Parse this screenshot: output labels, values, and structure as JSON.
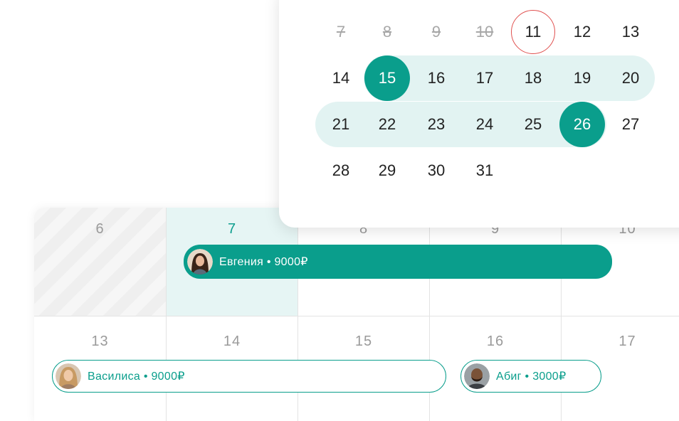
{
  "date_picker": {
    "weeks": [
      [
        {
          "d": "7",
          "state": "disabled"
        },
        {
          "d": "8",
          "state": "disabled"
        },
        {
          "d": "9",
          "state": "disabled"
        },
        {
          "d": "10",
          "state": "disabled"
        },
        {
          "d": "11",
          "state": "current"
        },
        {
          "d": "12",
          "state": "normal"
        },
        {
          "d": "13",
          "state": "normal"
        }
      ],
      [
        {
          "d": "14",
          "state": "normal"
        },
        {
          "d": "15",
          "state": "selected"
        },
        {
          "d": "16",
          "state": "normal"
        },
        {
          "d": "17",
          "state": "normal"
        },
        {
          "d": "18",
          "state": "normal"
        },
        {
          "d": "19",
          "state": "normal"
        },
        {
          "d": "20",
          "state": "normal"
        }
      ],
      [
        {
          "d": "21",
          "state": "normal"
        },
        {
          "d": "22",
          "state": "normal"
        },
        {
          "d": "23",
          "state": "normal"
        },
        {
          "d": "24",
          "state": "normal"
        },
        {
          "d": "25",
          "state": "normal"
        },
        {
          "d": "26",
          "state": "selected"
        },
        {
          "d": "27",
          "state": "normal"
        }
      ],
      [
        {
          "d": "28",
          "state": "normal"
        },
        {
          "d": "29",
          "state": "normal"
        },
        {
          "d": "30",
          "state": "normal"
        },
        {
          "d": "31",
          "state": "normal"
        }
      ]
    ]
  },
  "calendar": {
    "week1_days": [
      "6",
      "7",
      "8",
      "9",
      "10"
    ],
    "week2_days": [
      "13",
      "14",
      "15",
      "16",
      "17"
    ]
  },
  "bookings": [
    {
      "name": "Евгения",
      "price": "9000₽",
      "label": "Евгения • 9000₽",
      "style": "filled"
    },
    {
      "name": "Василиса",
      "price": "9000₽",
      "label": "Василиса • 9000₽",
      "style": "outlined"
    },
    {
      "name": "Абиг",
      "price": "3000₽",
      "label": "Абиг • 3000₽",
      "style": "outlined"
    }
  ],
  "colors": {
    "accent": "#0a9e8c",
    "range": "#e2f3f2",
    "today_ring": "#e0504f",
    "disabled_text": "#a8a8a8"
  }
}
